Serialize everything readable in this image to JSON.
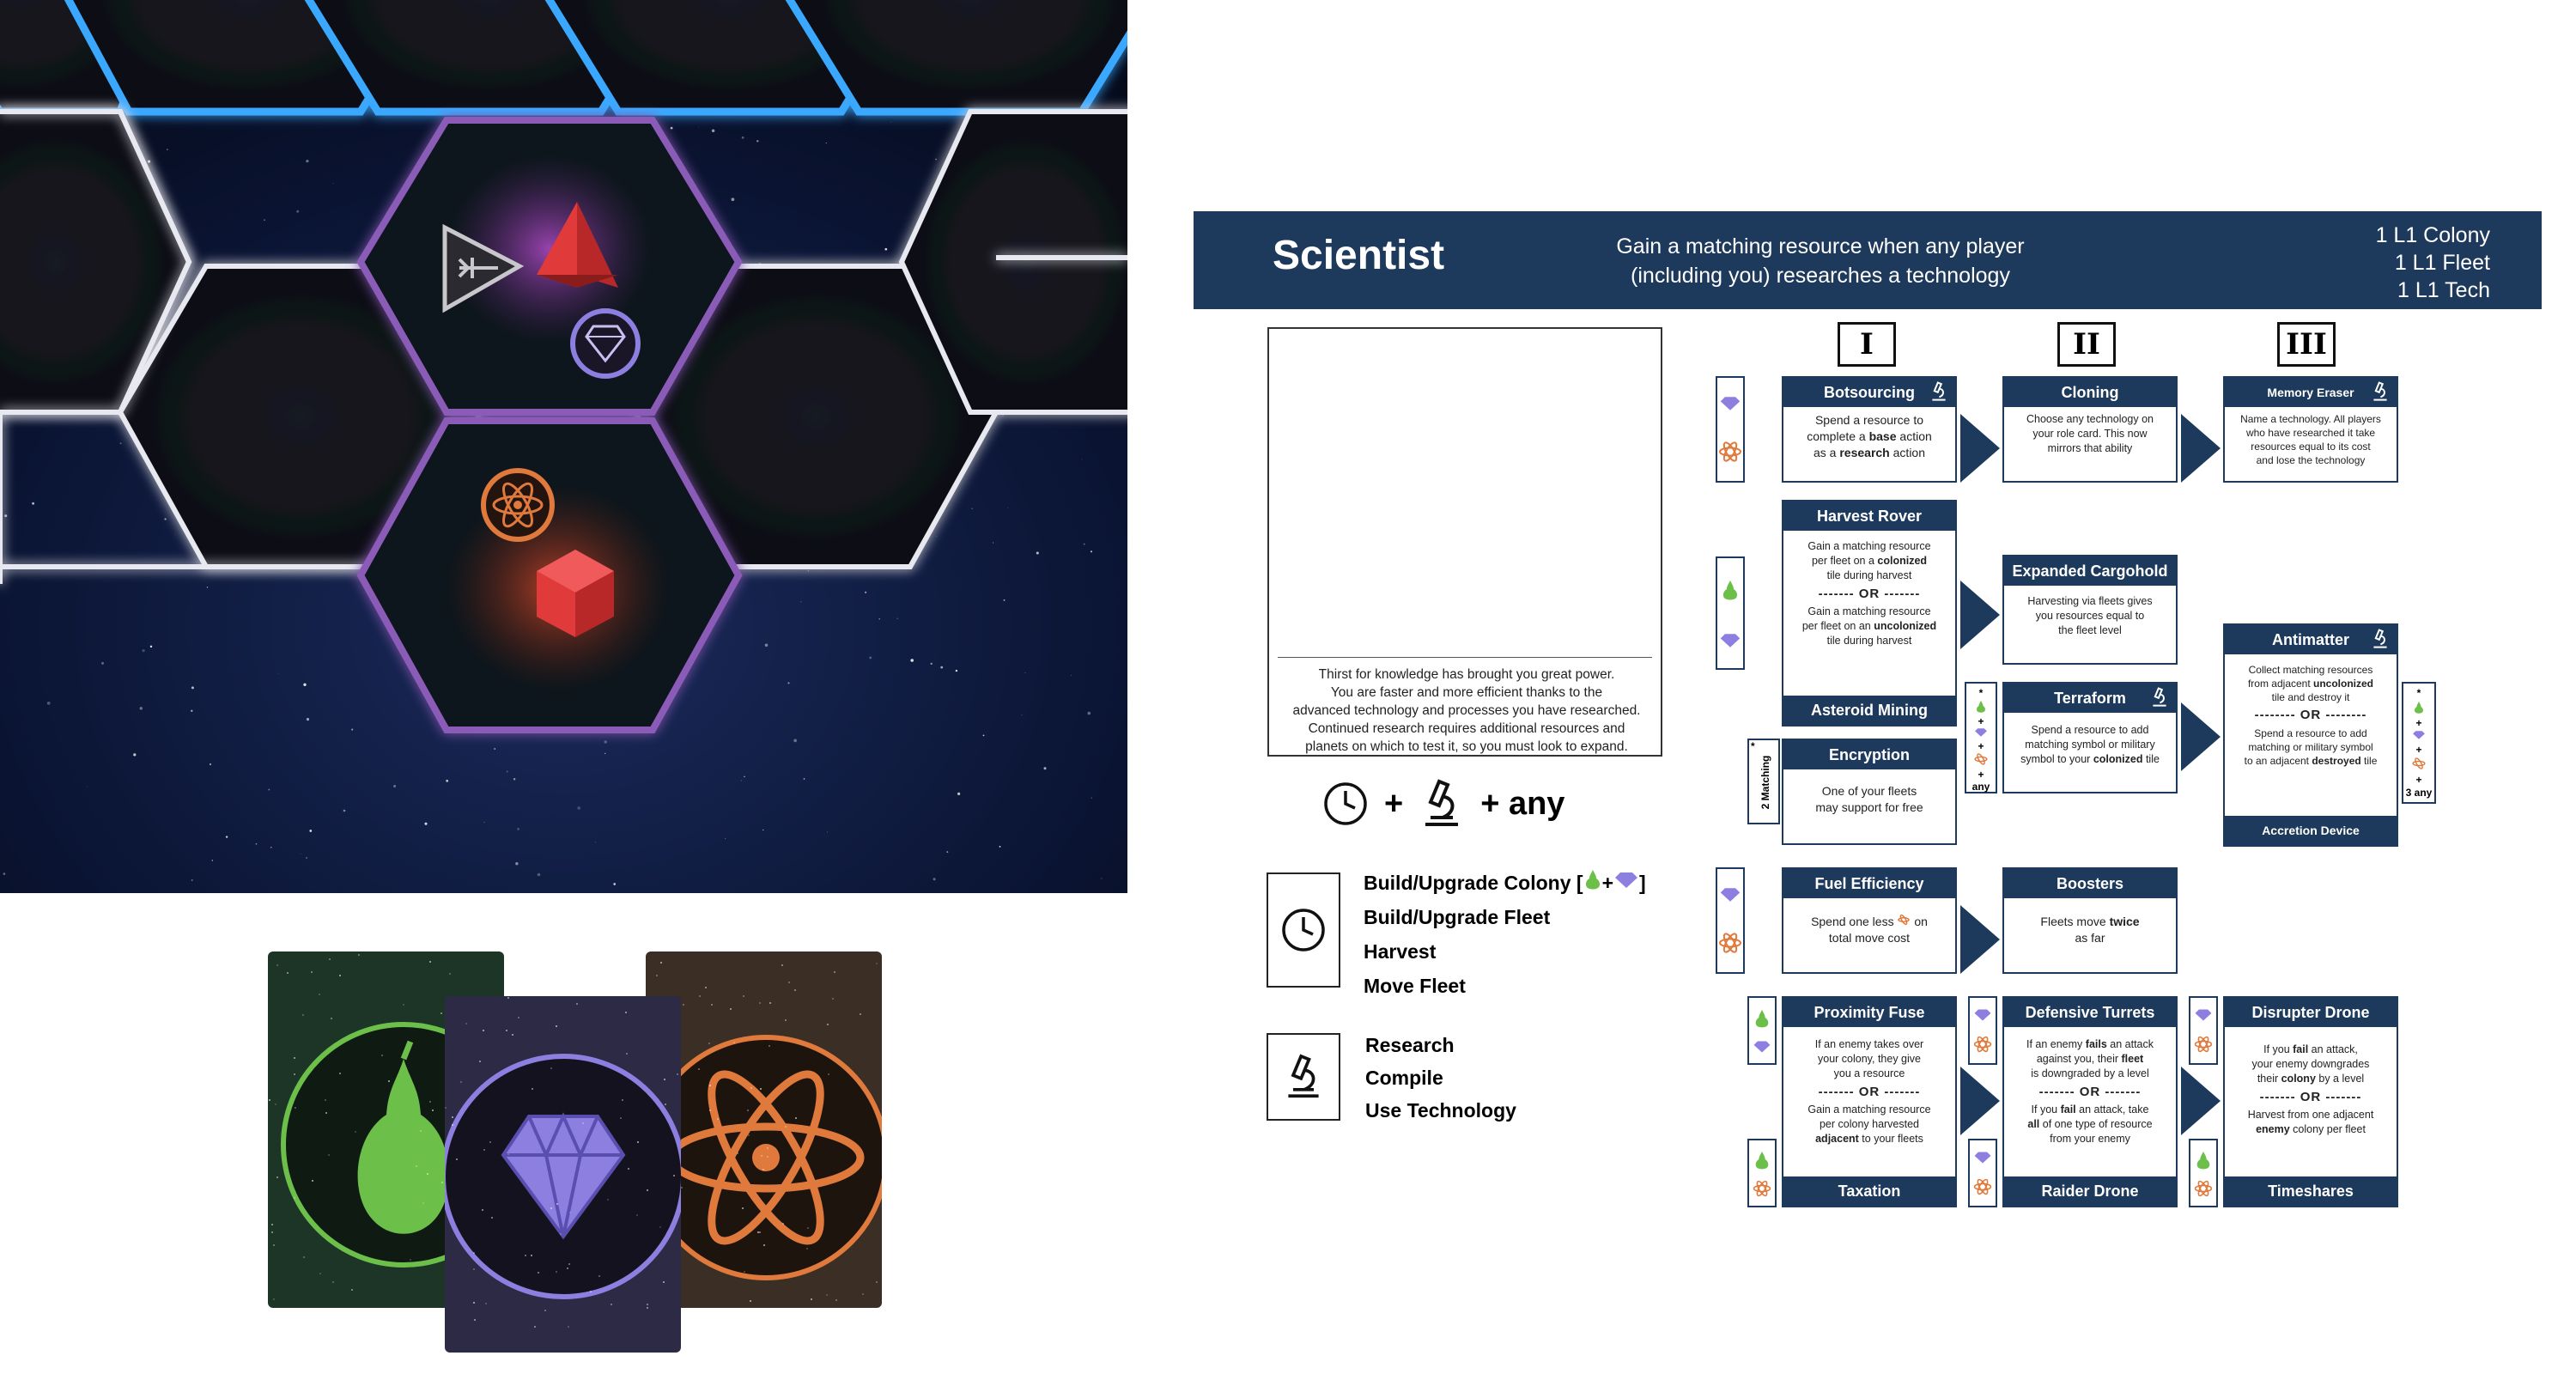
{
  "role": {
    "title": "Scientist",
    "description_line1": "Gain a matching resource when any player",
    "description_line2": "(including you) researches a technology",
    "starts": [
      "1 L1 Colony",
      "1 L1 Fleet",
      "1 L1 Tech"
    ],
    "flavor": [
      "Thirst for knowledge has brought you great power.",
      "You are faster and more efficient thanks to the",
      "advanced technology and processes you have researched.",
      "Continued research requires additional resources and",
      "planets on which to test it, so you must look to expand."
    ],
    "formula": {
      "plus1": "+",
      "plus2": "+ any"
    },
    "time_actions": {
      "items": [
        "Build/Upgrade Colony",
        "Build/Upgrade Fleet",
        "Harvest",
        "Move Fleet"
      ],
      "colony_cost_open": "[",
      "colony_cost_plus": "+",
      "colony_cost_close": "]"
    },
    "research_actions": {
      "items": [
        "Research",
        "Compile",
        "Use Technology"
      ]
    }
  },
  "levels": [
    "I",
    "II",
    "III"
  ],
  "techs": {
    "botsourcing": {
      "name": "Botsourcing",
      "t1": "Spend a resource to",
      "t2a": "complete a ",
      "t2b": "base",
      "t2c": " action",
      "t3a": "as a ",
      "t3b": "research",
      "t3c": " action"
    },
    "cloning": {
      "name": "Cloning",
      "t1": "Choose any technology on",
      "t2": "your role card. This now",
      "t3": "mirrors that ability"
    },
    "memory_eraser": {
      "name": "Memory Eraser",
      "t1": "Name a technology. All players",
      "t2": "who have researched it take",
      "t3": "resources equal to its cost",
      "t4": "and lose the technology"
    },
    "harvest_rover": {
      "name": "Harvest Rover",
      "t1": "Gain a matching resource",
      "t2a": "per fleet on a ",
      "t2b": "colonized",
      "t3": "tile during harvest",
      "or": "------- OR -------",
      "t4": "Gain a matching resource",
      "t5a": "per fleet on an ",
      "t5b": "uncolonized",
      "t6": "tile during harvest"
    },
    "asteroid_mining": {
      "name": "Asteroid Mining"
    },
    "expanded_cargohold": {
      "name": "Expanded Cargohold",
      "t1": "Harvesting via fleets gives",
      "t2": "you resources equal to",
      "t3": "the fleet level"
    },
    "terraform": {
      "name": "Terraform",
      "t1": "Spend a resource to add",
      "t2": "matching symbol or military",
      "t3a": "symbol to your ",
      "t3b": "colonized",
      "t3c": " tile",
      "side": "any"
    },
    "antimatter": {
      "name": "Antimatter",
      "t1": "Collect matching resources",
      "t2a": "from adjacent ",
      "t2b": "uncolonized",
      "t3": "tile and destroy it",
      "or": "-------- OR --------",
      "t4": "Spend a resource to add",
      "t5": "matching or military symbol",
      "t6a": "to an adjacent ",
      "t6b": "destroyed",
      "t6c": " tile",
      "side": "3 any"
    },
    "accretion_device": {
      "name": "Accretion Device"
    },
    "encryption": {
      "name": "Encryption",
      "t1": "One of your fleets",
      "t2": "may support for free",
      "side": "2 Matching"
    },
    "fuel_efficiency": {
      "name": "Fuel Efficiency",
      "t1a": "Spend one less ",
      "t1b": " on",
      "t2": "total move cost"
    },
    "boosters": {
      "name": "Boosters",
      "t1a": "Fleets move ",
      "t1b": "twice",
      "t2": "as far"
    },
    "proximity_fuse": {
      "name": "Proximity Fuse",
      "t1": "If an enemy takes over",
      "t2": "your colony, they give",
      "t3": "you a resource",
      "or": "------- OR -------",
      "t4": "Gain a matching resource",
      "t5": "per colony harvested",
      "t6a": "adjacent",
      "t6b": " to your fleets"
    },
    "taxation": {
      "name": "Taxation"
    },
    "defensive_turrets": {
      "name": "Defensive Turrets",
      "t1a": "If an enemy ",
      "t1b": "fails",
      "t1c": " an attack",
      "t2a": "against you, their ",
      "t2b": "fleet",
      "t3": "is downgraded by a level",
      "or": "------- OR -------",
      "t4a": "If you ",
      "t4b": "fail",
      "t4c": " an attack, take",
      "t5a": "all",
      "t5b": " of one type of resource",
      "t6": "from your enemy"
    },
    "raider_drone": {
      "name": "Raider Drone"
    },
    "disrupter_drone": {
      "name": "Disrupter Drone",
      "t1a": "If you ",
      "t1b": "fail",
      "t1c": " an attack,",
      "t2": "your enemy downgrades",
      "t3a": "their ",
      "t3b": "colony",
      "t3c": " by a level",
      "or": "------- OR -------",
      "t4": "Harvest from one adjacent",
      "t5a": "enemy",
      "t5b": " colony per fleet"
    },
    "timeshares": {
      "name": "Timeshares"
    }
  },
  "colors": {
    "navy": "#1d3a5c",
    "green": "#6cc04a",
    "purple": "#8c7fe0",
    "orange": "#e07a3c",
    "red": "#e23c3c",
    "hex_blue": "#3aa8ff",
    "hex_purple": "#8a5bb8"
  },
  "board": {
    "tokens": [
      "fleet-icon",
      "red-pyramid",
      "crystal-token",
      "atom-token",
      "red-cube"
    ]
  },
  "resource_cards": [
    "pear-card",
    "crystal-card",
    "atom-card"
  ]
}
